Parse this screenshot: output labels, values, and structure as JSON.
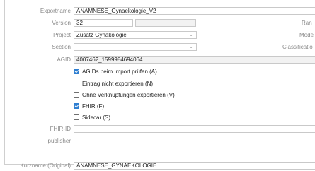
{
  "form": {
    "exportname": {
      "label": "Exportname",
      "value": "ANAMNESE_Gynaekologie_V2"
    },
    "version": {
      "label": "Version",
      "value": "32",
      "value2": ""
    },
    "project": {
      "label": "Project",
      "value": "Zusatz Gynäkologie"
    },
    "section": {
      "label": "Section",
      "value": ""
    },
    "agid": {
      "label": "AGID",
      "value": "4007462_1599984694064"
    },
    "checkboxes": [
      {
        "label": "AGIDs beim Import prüfen (A)",
        "checked": true
      },
      {
        "label": "Eintrag nicht exportieren (N)",
        "checked": false
      },
      {
        "label": "Ohne Verknüpfungen exportieren (V)",
        "checked": false
      },
      {
        "label": "FHIR (F)",
        "checked": true
      },
      {
        "label": "Sidecar (S)",
        "checked": false
      }
    ],
    "fhir_id": {
      "label": "FHIR-ID",
      "value": ""
    },
    "publisher": {
      "label": "publisher",
      "value": ""
    },
    "kurzname": {
      "label": "Kurzname (Original)",
      "value": "ANAMNESE_GYNAEKOLOGIE"
    }
  },
  "right_labels": {
    "ran": "Ran",
    "mode": "Mode",
    "classification": "Classificatio"
  },
  "icons": {
    "dropdown": "chevron-down-icon",
    "checked": "checkmark-icon"
  },
  "colors": {
    "checkbox_checked": "#2f7fd1",
    "label_text": "#8a8a8a",
    "border": "#c9c9c9"
  }
}
